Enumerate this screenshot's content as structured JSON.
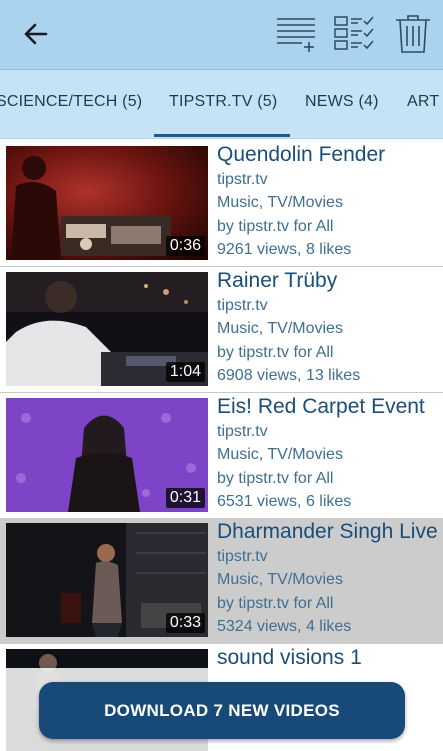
{
  "toolbar": {
    "back_icon": "arrow-left-icon",
    "add_playlist_icon": "playlist-add-icon",
    "select_all_icon": "checklist-icon",
    "delete_icon": "trash-icon"
  },
  "tabs": [
    {
      "label": "SCIENCE/TECH (5)"
    },
    {
      "label": "TIPSTR.TV (5)",
      "active": true
    },
    {
      "label": "NEWS (4)"
    },
    {
      "label": "ART"
    }
  ],
  "videos": [
    {
      "title": "Quendolin Fender",
      "source": "tipstr.tv",
      "category": "Music, TV/Movies",
      "by": "by tipstr.tv for All",
      "stats": "9261 views, 8 likes",
      "duration": "0:36"
    },
    {
      "title": "Rainer Trüby",
      "source": "tipstr.tv",
      "category": "Music, TV/Movies",
      "by": "by tipstr.tv for All",
      "stats": "6908 views, 13 likes",
      "duration": "1:04"
    },
    {
      "title": "Eis! Red Carpet Event",
      "source": "tipstr.tv",
      "category": "Music, TV/Movies",
      "by": "by tipstr.tv for All",
      "stats": "6531 views, 6 likes",
      "duration": "0:31"
    },
    {
      "title": "Dharmander Singh Live",
      "source": "tipstr.tv",
      "category": "Music, TV/Movies",
      "by": "by tipstr.tv for All",
      "stats": "5324 views, 4 likes",
      "duration": "0:33",
      "selected": true
    },
    {
      "title": "sound visions 1"
    }
  ],
  "download": {
    "label": "DOWNLOAD 7 NEW VIDEOS"
  },
  "colors": {
    "toolbar": "#a9d3ef",
    "tabs": "#c6e3f6",
    "accent": "#174a78",
    "title": "#1a4e78"
  }
}
